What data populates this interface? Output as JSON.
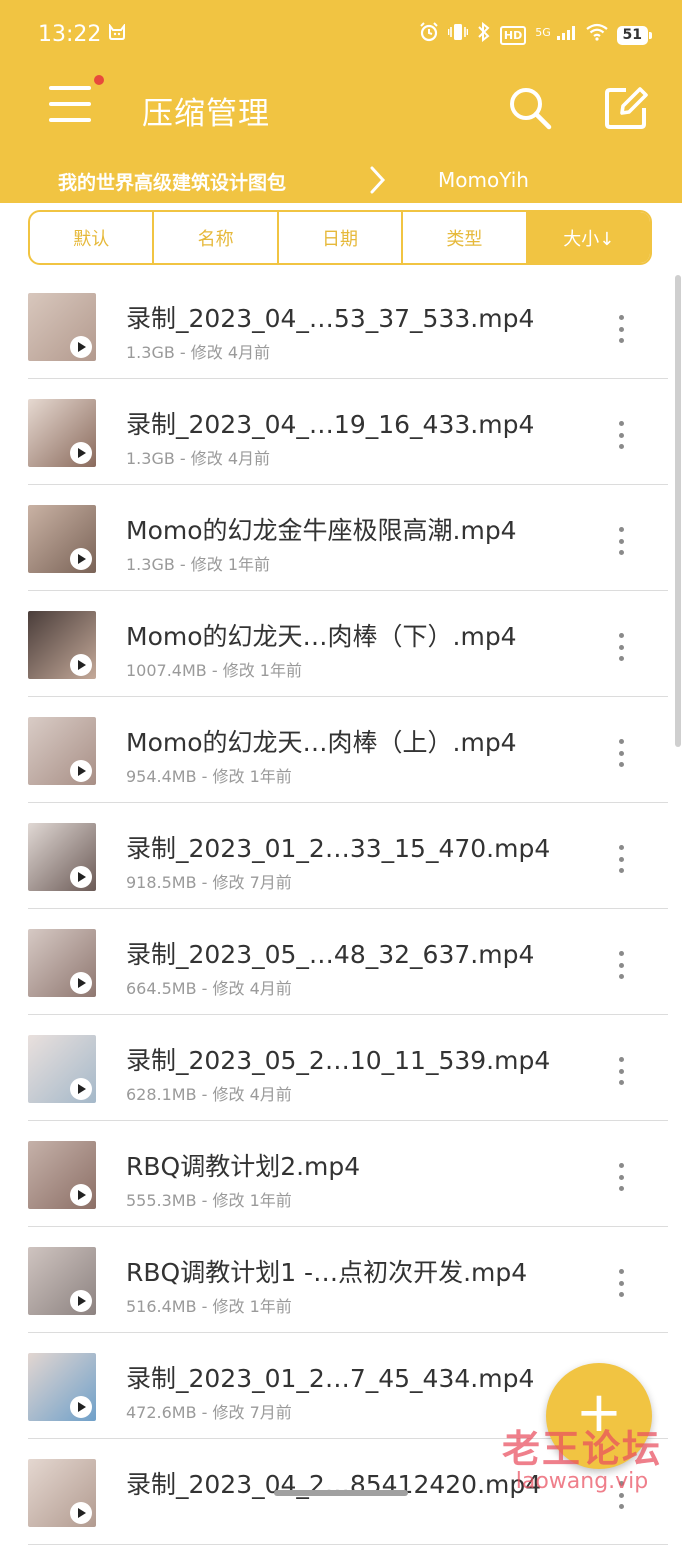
{
  "status_bar": {
    "time": "13:22",
    "network": "5G",
    "hd": "HD",
    "battery": "51"
  },
  "header": {
    "title": "压缩管理",
    "breadcrumb": [
      "我的世界高级建筑设计图包",
      "MomoYih"
    ],
    "accent_color": "#f1c442"
  },
  "sort_tabs": [
    {
      "label": "默认"
    },
    {
      "label": "名称"
    },
    {
      "label": "日期"
    },
    {
      "label": "类型"
    },
    {
      "label": "大小↓",
      "active": true
    }
  ],
  "files": [
    {
      "name": "录制_2023_04_…53_37_533.mp4",
      "meta": "1.3GB - 修改 4月前"
    },
    {
      "name": "录制_2023_04_…19_16_433.mp4",
      "meta": "1.3GB - 修改 4月前"
    },
    {
      "name": "Momo的幻龙金牛座极限高潮.mp4",
      "meta": "1.3GB - 修改 1年前"
    },
    {
      "name": "Momo的幻龙天…肉棒（下）.mp4",
      "meta": "1007.4MB - 修改 1年前"
    },
    {
      "name": "Momo的幻龙天…肉棒（上）.mp4",
      "meta": "954.4MB - 修改 1年前"
    },
    {
      "name": "录制_2023_01_2…33_15_470.mp4",
      "meta": "918.5MB - 修改 7月前"
    },
    {
      "name": "录制_2023_05_…48_32_637.mp4",
      "meta": "664.5MB - 修改 4月前"
    },
    {
      "name": "录制_2023_05_2…10_11_539.mp4",
      "meta": "628.1MB - 修改 4月前"
    },
    {
      "name": "RBQ调教计划2.mp4",
      "meta": "555.3MB - 修改 1年前"
    },
    {
      "name": "RBQ调教计划1 -…点初次开发.mp4",
      "meta": "516.4MB - 修改 1年前"
    },
    {
      "name": "录制_2023_01_2…7_45_434.mp4",
      "meta": "472.6MB - 修改 7月前"
    },
    {
      "name": "录制_2023_04_2…85412420.mp4",
      "meta": ""
    }
  ],
  "fab": {
    "symbol": "+"
  },
  "watermark": {
    "line1": "老王论坛",
    "line2": "laowang.vip"
  }
}
